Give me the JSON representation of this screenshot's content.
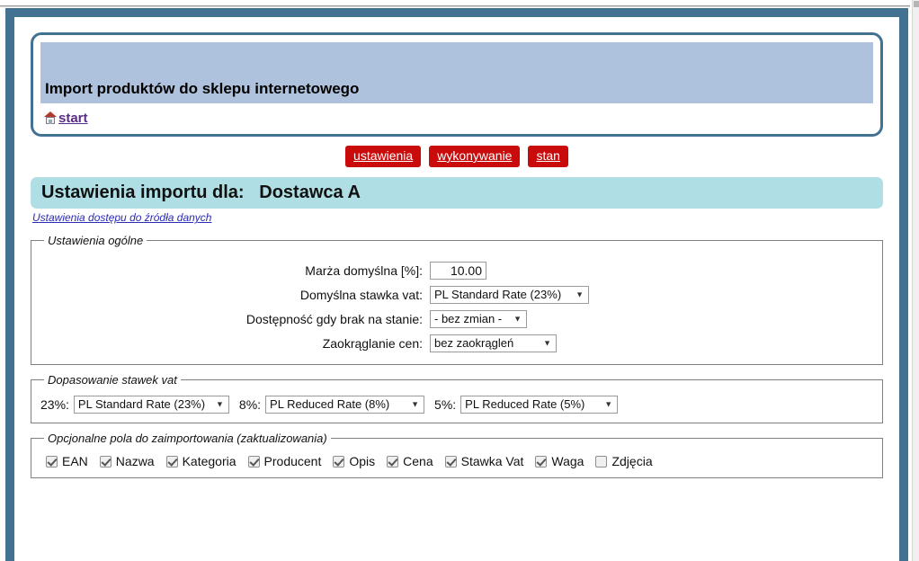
{
  "header": {
    "app_title": "Import produktów do sklepu internetowego",
    "home_icon": "home-icon",
    "start_label": "start"
  },
  "nav": {
    "buttons": [
      {
        "label": "ustawienia"
      },
      {
        "label": "wykonywanie"
      },
      {
        "label": "stan"
      }
    ]
  },
  "content": {
    "settings_title": "Ustawienia importu dla:   Dostawca A",
    "source_settings_link": "Ustawienia dostępu do źródła danych"
  },
  "general": {
    "legend": "Ustawienia ogólne",
    "rows": [
      {
        "label": "Marża domyślna [%]:",
        "value": "10.00",
        "type": "text"
      },
      {
        "label": "Domyślna stawka vat:",
        "value": "PL Standard Rate (23%)",
        "type": "select"
      },
      {
        "label": "Dostępność gdy brak na stanie:",
        "value": "- bez zmian -",
        "type": "select"
      },
      {
        "label": "Zaokrąglanie cen:",
        "value": "bez zaokrągleń",
        "type": "select"
      }
    ]
  },
  "vat_matching": {
    "legend": "Dopasowanie stawek vat",
    "items": [
      {
        "label": "23%:",
        "value": "PL Standard Rate (23%)"
      },
      {
        "label": "8%:",
        "value": "PL Reduced Rate (8%)"
      },
      {
        "label": "5%:",
        "value": "PL Reduced Rate (5%)"
      }
    ]
  },
  "optional_fields": {
    "legend": "Opcjonalne pola do zaimportowania (zaktualizowania)",
    "items": [
      {
        "label": "EAN",
        "checked": true
      },
      {
        "label": "Nazwa",
        "checked": true
      },
      {
        "label": "Kategoria",
        "checked": true
      },
      {
        "label": "Producent",
        "checked": true
      },
      {
        "label": "Opis",
        "checked": true
      },
      {
        "label": "Cena",
        "checked": true
      },
      {
        "label": "Stawka Vat",
        "checked": true
      },
      {
        "label": "Waga",
        "checked": true
      },
      {
        "label": "Zdjęcia",
        "checked": false
      }
    ]
  },
  "colors": {
    "frame": "#427191",
    "banner": "#afc2dd",
    "title_bar": "#afdfe4",
    "nav_button": "#c90b0b",
    "link": "#5a2c86"
  },
  "caret_glyph": "▼"
}
